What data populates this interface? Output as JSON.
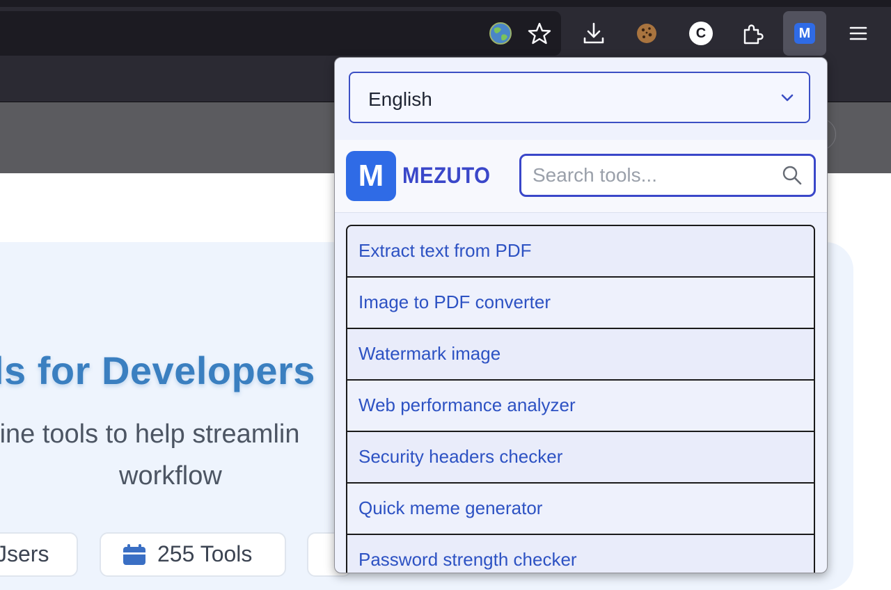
{
  "browser": {
    "toolbar_icons": [
      "globe-icon",
      "star-icon",
      "download-icon",
      "cookie-icon",
      "c-extension-icon",
      "puzzle-icon",
      "mezuto-extension-icon",
      "menu-icon"
    ],
    "extension_badge_letter": "M",
    "c_badge_letter": "C"
  },
  "background_page": {
    "hero_title": "ls for Developers",
    "hero_subtitle_line1": "nline tools to help streamlin",
    "hero_subtitle_line2": "workflow",
    "stats": [
      {
        "text": "Jsers",
        "icon": "users-icon"
      },
      {
        "text": "255 Tools",
        "icon": "calendar-icon"
      }
    ]
  },
  "popup": {
    "language": {
      "selected": "English"
    },
    "brand": {
      "logo_letter": "M",
      "name": "MEZUTO"
    },
    "search": {
      "placeholder": "Search tools...",
      "value": ""
    },
    "tools": [
      "Extract text from PDF",
      "Image to PDF converter",
      "Watermark image",
      "Web performance analyzer",
      "Security headers checker",
      "Quick meme generator",
      "Password strength checker"
    ]
  },
  "colors": {
    "accent": "#3a47c9",
    "logo_bg": "#2f6be6",
    "link": "#2d52c3",
    "hero_title": "#3a7fc0"
  }
}
